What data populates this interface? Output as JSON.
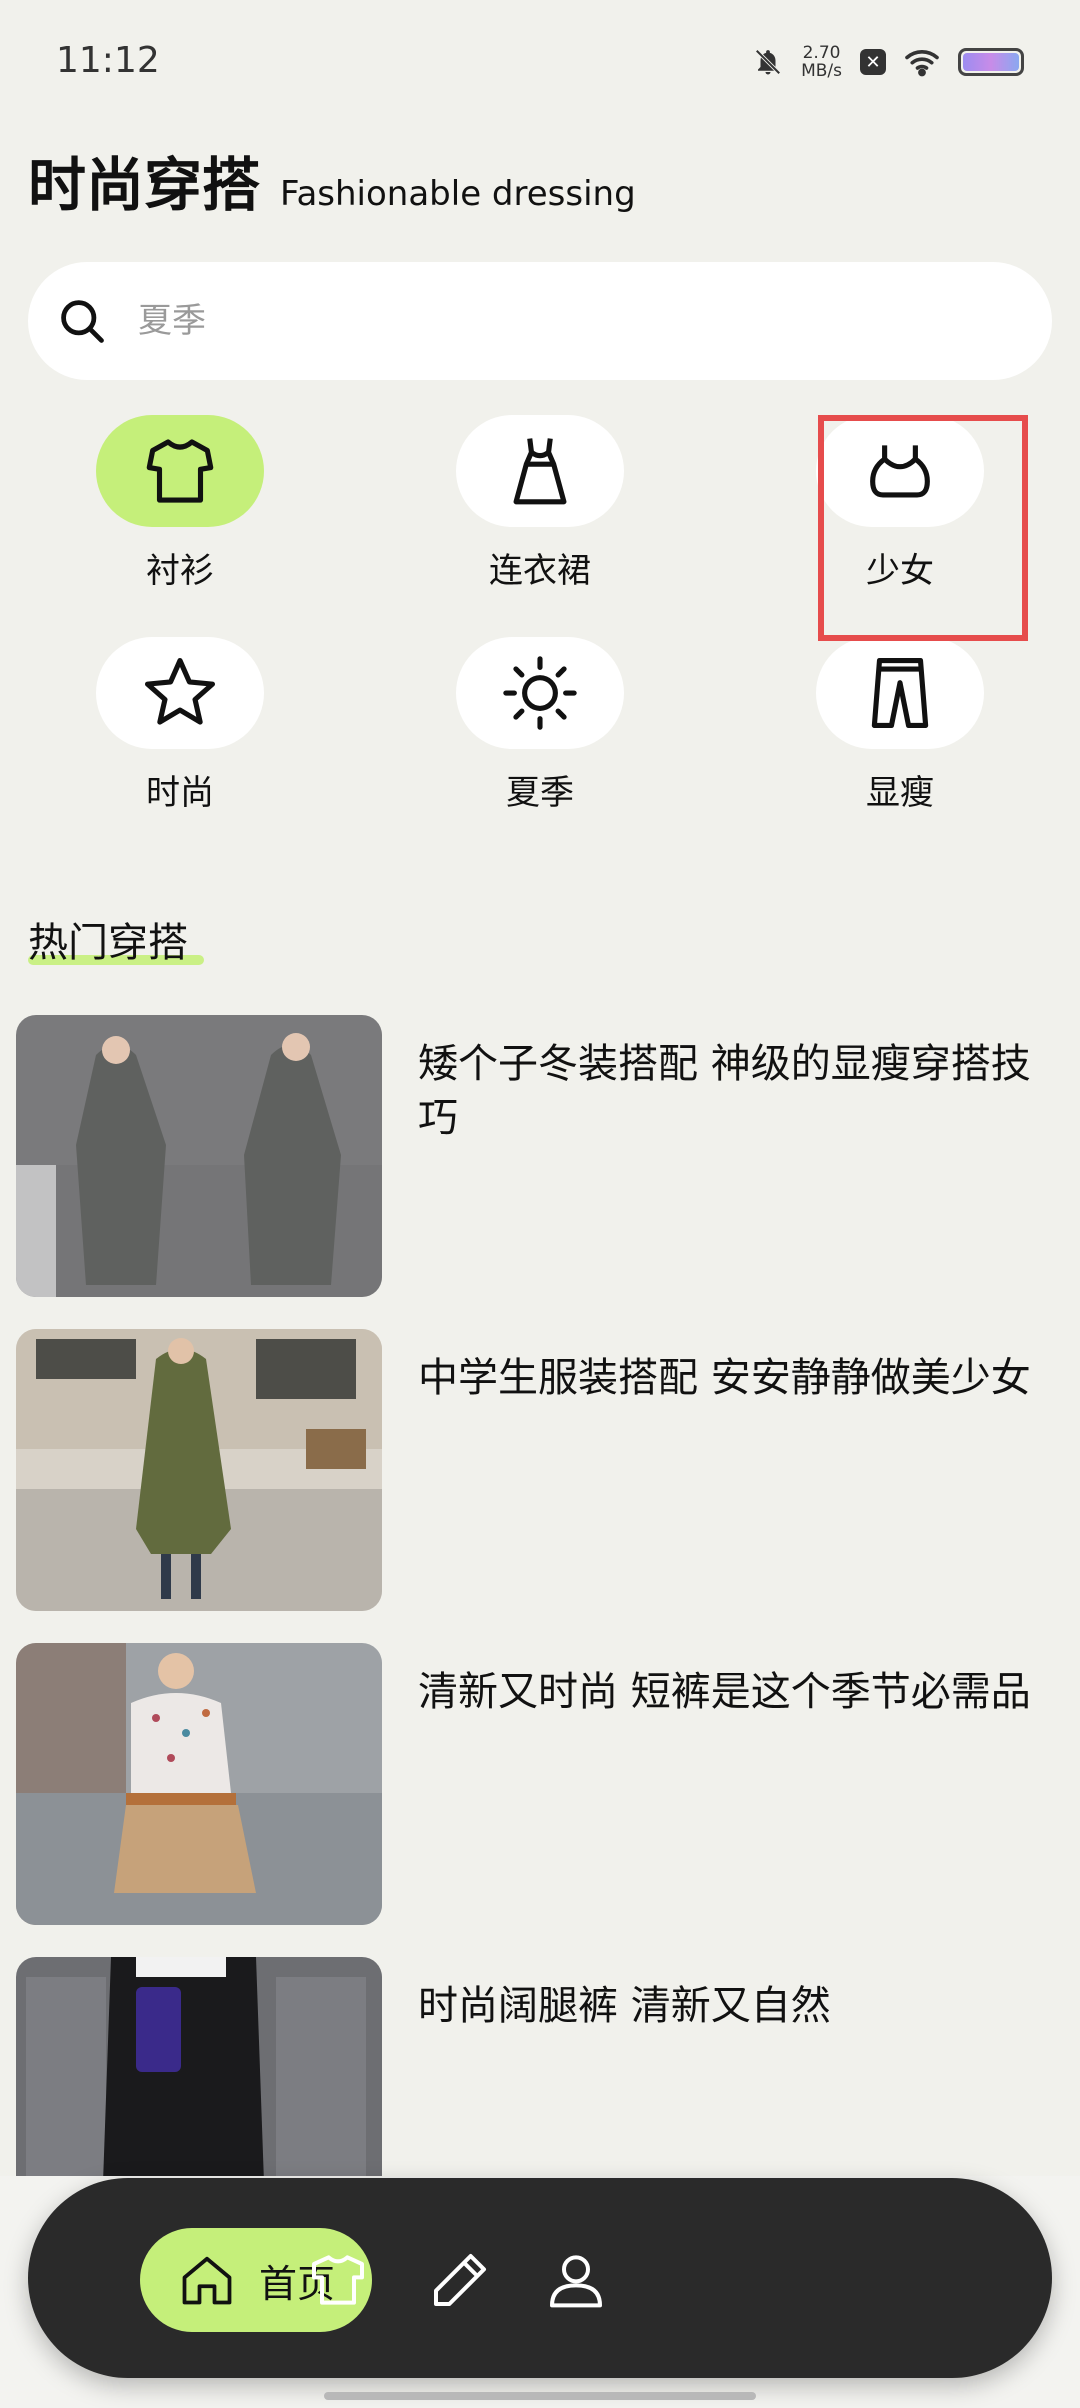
{
  "status_bar": {
    "time": "11:12",
    "net_speed_value": "2.70",
    "net_speed_unit": "MB/s"
  },
  "header": {
    "title": "时尚穿搭",
    "subtitle": "Fashionable dressing"
  },
  "search": {
    "placeholder": "夏季",
    "value": ""
  },
  "categories": [
    {
      "label": "衬衫",
      "icon": "shirt-icon",
      "active": true
    },
    {
      "label": "连衣裙",
      "icon": "dress-icon",
      "active": false
    },
    {
      "label": "少女",
      "icon": "tank-top-icon",
      "active": false
    },
    {
      "label": "时尚",
      "icon": "star-icon",
      "active": false
    },
    {
      "label": "夏季",
      "icon": "sun-icon",
      "active": false
    },
    {
      "label": "显瘦",
      "icon": "pants-icon",
      "active": false
    }
  ],
  "section": {
    "title": "热门穿搭"
  },
  "articles": [
    {
      "title": "矮个子冬装搭配 神级的显瘦穿搭技巧"
    },
    {
      "title": "中学生服装搭配 安安静静做美少女"
    },
    {
      "title": "清新又时尚  短裤是这个季节必需品"
    },
    {
      "title": "时尚阔腿裤  清新又自然"
    }
  ],
  "bottom_nav": {
    "home_label": "首页",
    "items": [
      "home-icon",
      "shirt-icon",
      "pencil-icon",
      "user-icon"
    ]
  },
  "colors": {
    "accent": "#c5ef7a",
    "nav_bg": "#2a2a2a",
    "page_bg": "#f1f1ec",
    "highlight": "#e64c4c"
  }
}
